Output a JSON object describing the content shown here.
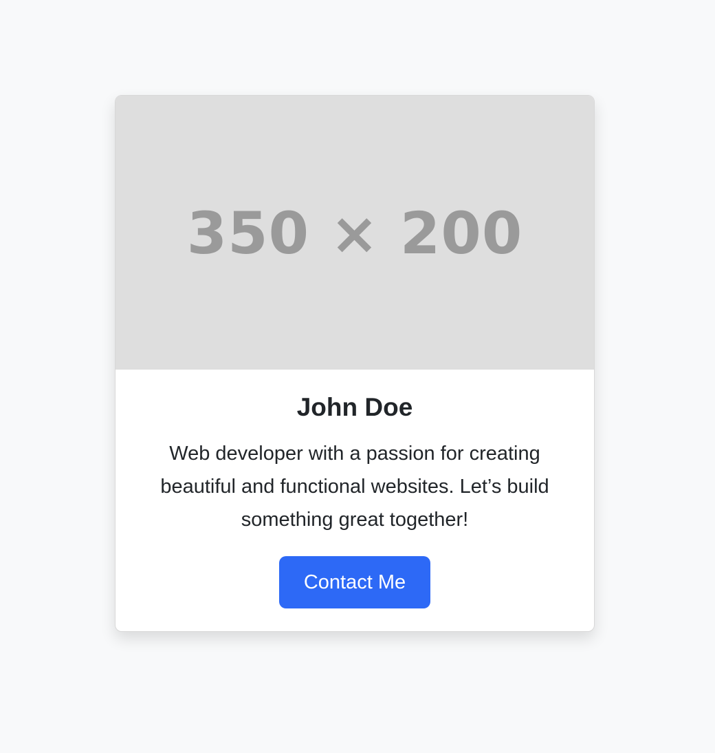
{
  "card": {
    "image_placeholder_text": "350 × 200",
    "name": "John Doe",
    "description": "Web developer with a passion for creating beautiful and functional websites. Let’s build something great together!",
    "button_label": "Contact Me"
  },
  "colors": {
    "page_background": "#f8f9fa",
    "card_background": "#ffffff",
    "image_background": "#dedede",
    "image_text": "#9a9a9a",
    "button_background": "#2d69f6",
    "text": "#212529"
  }
}
